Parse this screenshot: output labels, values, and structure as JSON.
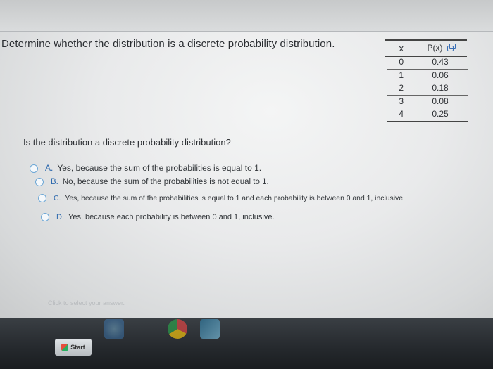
{
  "question": "Determine whether the distribution is a discrete probability distribution.",
  "table": {
    "header_x": "x",
    "header_p": "P(x)",
    "rows": [
      {
        "x": "0",
        "p": "0.43"
      },
      {
        "x": "1",
        "p": "0.06"
      },
      {
        "x": "2",
        "p": "0.18"
      },
      {
        "x": "3",
        "p": "0.08"
      },
      {
        "x": "4",
        "p": "0.25"
      }
    ]
  },
  "sub_question": "Is the distribution a discrete probability distribution?",
  "options": [
    {
      "letter": "A.",
      "text": "Yes, because the sum of the probabilities is equal to 1."
    },
    {
      "letter": "B.",
      "text": "No, because the sum of the probabilities is not equal to 1."
    },
    {
      "letter": "C.",
      "text": "Yes, because the sum of the probabilities is equal to 1 and each probability is between 0 and 1, inclusive."
    },
    {
      "letter": "D.",
      "text": "Yes, because each probability is between 0 and 1, inclusive."
    }
  ],
  "hint": "Click to select your answer.",
  "taskbar": {
    "start_label": "Start"
  },
  "icons": {
    "copy": "copy-icon",
    "start": "windows-logo-icon",
    "ie": "internet-explorer-icon",
    "chrome": "chrome-icon",
    "app": "app-icon"
  }
}
